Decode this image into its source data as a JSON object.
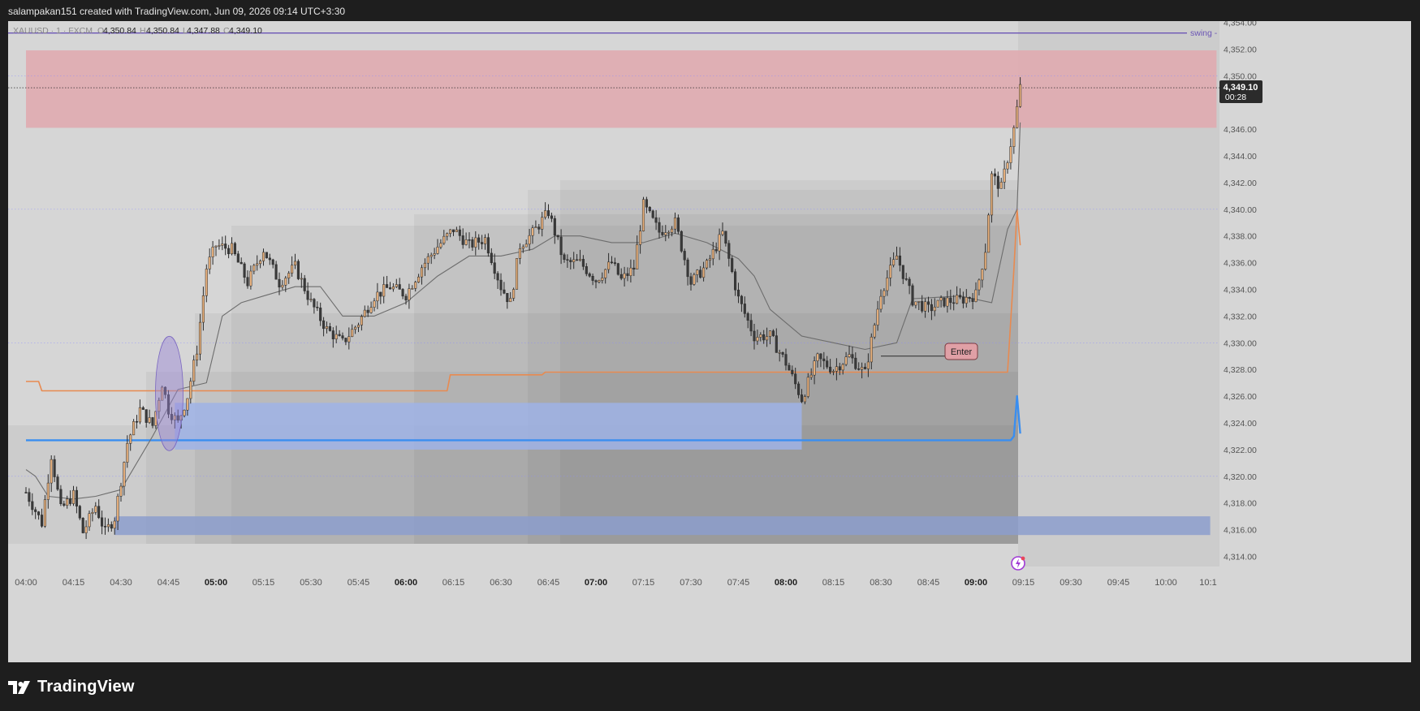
{
  "header": {
    "attribution": "salampakan151 created with TradingView.com, Jun 09, 2026 09:14 UTC+3:30"
  },
  "symbol_bar": {
    "symbol": "XAUUSD · 1 · FXCM",
    "o_label": "O",
    "o": "4,350.84",
    "h_label": "H",
    "h": "4,350.84",
    "l_label": "L",
    "l": "4,347.88",
    "c_label": "C",
    "c": "4,349.10"
  },
  "swing_label": "swing -",
  "enter_label": "Enter",
  "price_tag": {
    "price": "4,349.10",
    "countdown": "00:28"
  },
  "brand": {
    "name": "TradingView",
    "icon": "tradingview-logo-icon"
  },
  "colors": {
    "chart_bg": "#d6d6d6",
    "bull": "#e7b07c",
    "bear": "#3a3a3a",
    "supply_zone": "#e0a8ae",
    "demand_zone": "#9fb3e6",
    "swing_line": "#6b55b5",
    "orange_line": "#e88a50",
    "blue_line": "#3a8ef0",
    "grey_line": "#6d6d6d"
  },
  "chart_data": {
    "type": "candlestick",
    "symbol": "XAUUSD",
    "interval": "1",
    "y_axis": {
      "range": [
        4313,
        4355
      ],
      "ticks": [
        4354,
        4352,
        4350,
        4348,
        4346,
        4344,
        4342,
        4340,
        4338,
        4336,
        4334,
        4332,
        4330,
        4328,
        4326,
        4324,
        4322,
        4320,
        4318,
        4316,
        4314
      ],
      "tick_labels": [
        "4,354.00",
        "4,352.00",
        "4,350.00",
        "4,348.00",
        "4,346.00",
        "4,344.00",
        "4,342.00",
        "4,340.00",
        "4,338.00",
        "4,336.00",
        "4,334.00",
        "4,332.00",
        "4,330.00",
        "4,328.00",
        "4,326.00",
        "4,324.00",
        "4,322.00",
        "4,320.00",
        "4,318.00",
        "4,316.00",
        "4,314.00"
      ]
    },
    "x_axis": {
      "ticks": [
        "04:00",
        "04:15",
        "04:30",
        "04:45",
        "05:00",
        "05:15",
        "05:30",
        "05:45",
        "06:00",
        "06:15",
        "06:30",
        "06:45",
        "07:00",
        "07:15",
        "07:30",
        "07:45",
        "08:00",
        "08:15",
        "08:30",
        "08:45",
        "09:00",
        "09:15",
        "09:30",
        "09:45",
        "10:00",
        "10:1"
      ],
      "bold_ticks": [
        "05:00",
        "06:00",
        "07:00",
        "08:00",
        "09:00"
      ]
    },
    "zones": [
      {
        "name": "supply",
        "from_time": "04:00",
        "to_time": "10:16",
        "low": 4346.1,
        "high": 4351.9,
        "color": "#e0a8ae"
      },
      {
        "name": "demand-upper",
        "from_time": "04:47",
        "to_time": "08:05",
        "low": 4322.0,
        "high": 4325.5,
        "color": "#9fb3e6"
      },
      {
        "name": "demand-lower",
        "from_time": "04:28",
        "to_time": "10:14",
        "low": 4315.6,
        "high": 4317.0,
        "color": "#8c9dcc"
      }
    ],
    "levels": [
      {
        "name": "swing",
        "value": 4353.2,
        "label": "swing -"
      },
      {
        "name": "last-price",
        "value": 4349.1,
        "label": "4,349.10"
      }
    ],
    "series": [
      {
        "name": "orange-line",
        "points": [
          [
            "04:00",
            4327.1
          ],
          [
            "04:04",
            4327.1
          ],
          [
            "04:05",
            4326.4
          ],
          [
            "06:13",
            4326.4
          ],
          [
            "06:14",
            4327.6
          ],
          [
            "06:43",
            4327.6
          ],
          [
            "06:44",
            4327.8
          ],
          [
            "09:10",
            4327.8
          ],
          [
            "09:12",
            4335.5
          ],
          [
            "09:13",
            4340.0
          ],
          [
            "09:14",
            4337.3
          ]
        ]
      },
      {
        "name": "blue-line",
        "points": [
          [
            "04:00",
            4322.7
          ],
          [
            "09:11",
            4322.7
          ],
          [
            "09:12",
            4323.0
          ],
          [
            "09:13",
            4326.0
          ],
          [
            "09:14",
            4323.2
          ]
        ]
      },
      {
        "name": "grey-line",
        "points": [
          [
            "04:00",
            4320.5
          ],
          [
            "04:03",
            4320.0
          ],
          [
            "04:07",
            4318.5
          ],
          [
            "04:15",
            4318.3
          ],
          [
            "04:22",
            4318.5
          ],
          [
            "04:30",
            4319.0
          ],
          [
            "04:40",
            4323.0
          ],
          [
            "04:48",
            4326.5
          ],
          [
            "04:57",
            4327.0
          ],
          [
            "05:02",
            4332.0
          ],
          [
            "05:08",
            4333.0
          ],
          [
            "05:15",
            4333.5
          ],
          [
            "05:25",
            4334.2
          ],
          [
            "05:33",
            4334.2
          ],
          [
            "05:40",
            4332.0
          ],
          [
            "05:50",
            4332.0
          ],
          [
            "06:00",
            4333.0
          ],
          [
            "06:10",
            4335.0
          ],
          [
            "06:20",
            4336.5
          ],
          [
            "06:30",
            4336.5
          ],
          [
            "06:40",
            4337.0
          ],
          [
            "06:47",
            4338.0
          ],
          [
            "06:55",
            4338.0
          ],
          [
            "07:05",
            4337.5
          ],
          [
            "07:15",
            4337.5
          ],
          [
            "07:25",
            4338.2
          ],
          [
            "07:35",
            4337.5
          ],
          [
            "07:45",
            4336.3
          ],
          [
            "07:50",
            4335.0
          ],
          [
            "07:55",
            4332.5
          ],
          [
            "08:05",
            4330.5
          ],
          [
            "08:15",
            4330.0
          ],
          [
            "08:25",
            4329.5
          ],
          [
            "08:35",
            4330.0
          ],
          [
            "08:40",
            4333.3
          ],
          [
            "08:55",
            4333.5
          ],
          [
            "09:05",
            4333.0
          ],
          [
            "09:10",
            4338.5
          ],
          [
            "09:13",
            4340.0
          ],
          [
            "09:14",
            4346.5
          ]
        ]
      },
      {
        "name": "price",
        "points": [
          [
            "04:00",
            4318.8
          ],
          [
            "04:05",
            4316.5
          ],
          [
            "04:08",
            4321.6
          ],
          [
            "04:11",
            4317.5
          ],
          [
            "04:15",
            4318.6
          ],
          [
            "04:18",
            4315.8
          ],
          [
            "04:22",
            4317.8
          ],
          [
            "04:25",
            4315.8
          ],
          [
            "04:28",
            4316.9
          ],
          [
            "04:32",
            4322.5
          ],
          [
            "04:36",
            4325.0
          ],
          [
            "04:40",
            4323.8
          ],
          [
            "04:43",
            4327.0
          ],
          [
            "04:45",
            4325.0
          ],
          [
            "04:48",
            4324.0
          ],
          [
            "04:51",
            4326.0
          ],
          [
            "04:54",
            4329.5
          ],
          [
            "04:57",
            4335.6
          ],
          [
            "05:00",
            4337.3
          ],
          [
            "05:05",
            4337.0
          ],
          [
            "05:10",
            4334.5
          ],
          [
            "05:15",
            4337.0
          ],
          [
            "05:20",
            4334.5
          ],
          [
            "05:25",
            4335.7
          ],
          [
            "05:30",
            4333.0
          ],
          [
            "05:35",
            4331.0
          ],
          [
            "05:40",
            4330.0
          ],
          [
            "05:45",
            4331.5
          ],
          [
            "05:50",
            4333.5
          ],
          [
            "05:55",
            4334.2
          ],
          [
            "06:00",
            4333.6
          ],
          [
            "06:05",
            4335.7
          ],
          [
            "06:10",
            4337.2
          ],
          [
            "06:15",
            4338.5
          ],
          [
            "06:20",
            4337.3
          ],
          [
            "06:25",
            4337.8
          ],
          [
            "06:30",
            4334.2
          ],
          [
            "06:33",
            4333.0
          ],
          [
            "06:36",
            4337.3
          ],
          [
            "06:40",
            4338.2
          ],
          [
            "06:45",
            4339.8
          ],
          [
            "06:50",
            4336.0
          ],
          [
            "06:55",
            4336.0
          ],
          [
            "07:00",
            4334.7
          ],
          [
            "07:05",
            4336.0
          ],
          [
            "07:08",
            4334.7
          ],
          [
            "07:12",
            4335.6
          ],
          [
            "07:15",
            4340.3
          ],
          [
            "07:20",
            4338.3
          ],
          [
            "07:25",
            4339.0
          ],
          [
            "07:30",
            4334.5
          ],
          [
            "07:35",
            4335.8
          ],
          [
            "07:40",
            4338.2
          ],
          [
            "07:45",
            4333.3
          ],
          [
            "07:50",
            4330.5
          ],
          [
            "07:55",
            4330.5
          ],
          [
            "08:00",
            4328.5
          ],
          [
            "08:05",
            4325.8
          ],
          [
            "08:10",
            4328.8
          ],
          [
            "08:15",
            4328.0
          ],
          [
            "08:20",
            4329.0
          ],
          [
            "08:25",
            4327.7
          ],
          [
            "08:30",
            4333.8
          ],
          [
            "08:35",
            4336.5
          ],
          [
            "08:40",
            4333.2
          ],
          [
            "08:45",
            4332.5
          ],
          [
            "08:50",
            4333.1
          ],
          [
            "08:55",
            4333.2
          ],
          [
            "09:00",
            4333.6
          ],
          [
            "09:03",
            4337.0
          ],
          [
            "09:05",
            4342.5
          ],
          [
            "09:08",
            4341.6
          ],
          [
            "09:10",
            4343.8
          ],
          [
            "09:12",
            4346.0
          ],
          [
            "09:14",
            4349.1
          ]
        ]
      }
    ],
    "annotations": [
      {
        "type": "label",
        "text": "Enter",
        "value": 4329.0
      },
      {
        "type": "highlight-ellipse",
        "time": "04:45",
        "low": 4322.4,
        "high": 4330.0
      }
    ]
  }
}
